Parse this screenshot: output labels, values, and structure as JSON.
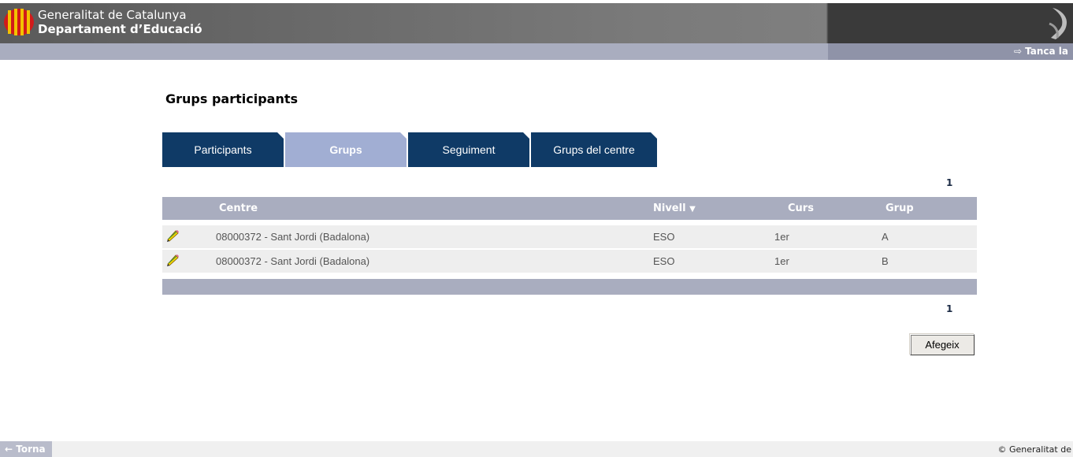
{
  "header": {
    "brand_line1": "Generalitat de Catalunya",
    "brand_line2": "Departament d’Educació",
    "close_label": "Tanca la",
    "close_arrow": "⇨"
  },
  "page": {
    "title": "Grups participants"
  },
  "tabs": [
    {
      "label": "Participants",
      "active": false
    },
    {
      "label": "Grups",
      "active": true
    },
    {
      "label": "Seguiment",
      "active": false
    },
    {
      "label": "Grups del centre",
      "active": false
    }
  ],
  "pager": {
    "top_page": "1",
    "bottom_page": "1"
  },
  "table": {
    "columns": [
      "Centre",
      "Nivell",
      "Curs",
      "Grup"
    ],
    "sort_indicator": "▼",
    "rows": [
      {
        "centre": "08000372 - Sant Jordi (Badalona)",
        "nivell": "ESO",
        "curs": "1er",
        "grup": "A"
      },
      {
        "centre": "08000372 - Sant Jordi (Badalona)",
        "nivell": "ESO",
        "curs": "1er",
        "grup": "B"
      }
    ]
  },
  "actions": {
    "add_label": "Afegeix"
  },
  "footer": {
    "back_label": "← Torna",
    "copyright": "© Generalitat de"
  },
  "colors": {
    "tab_dark": "#0f3a66",
    "tab_active": "#a1aed3",
    "table_header": "#a9adbf",
    "row_bg": "#eeeeee"
  }
}
